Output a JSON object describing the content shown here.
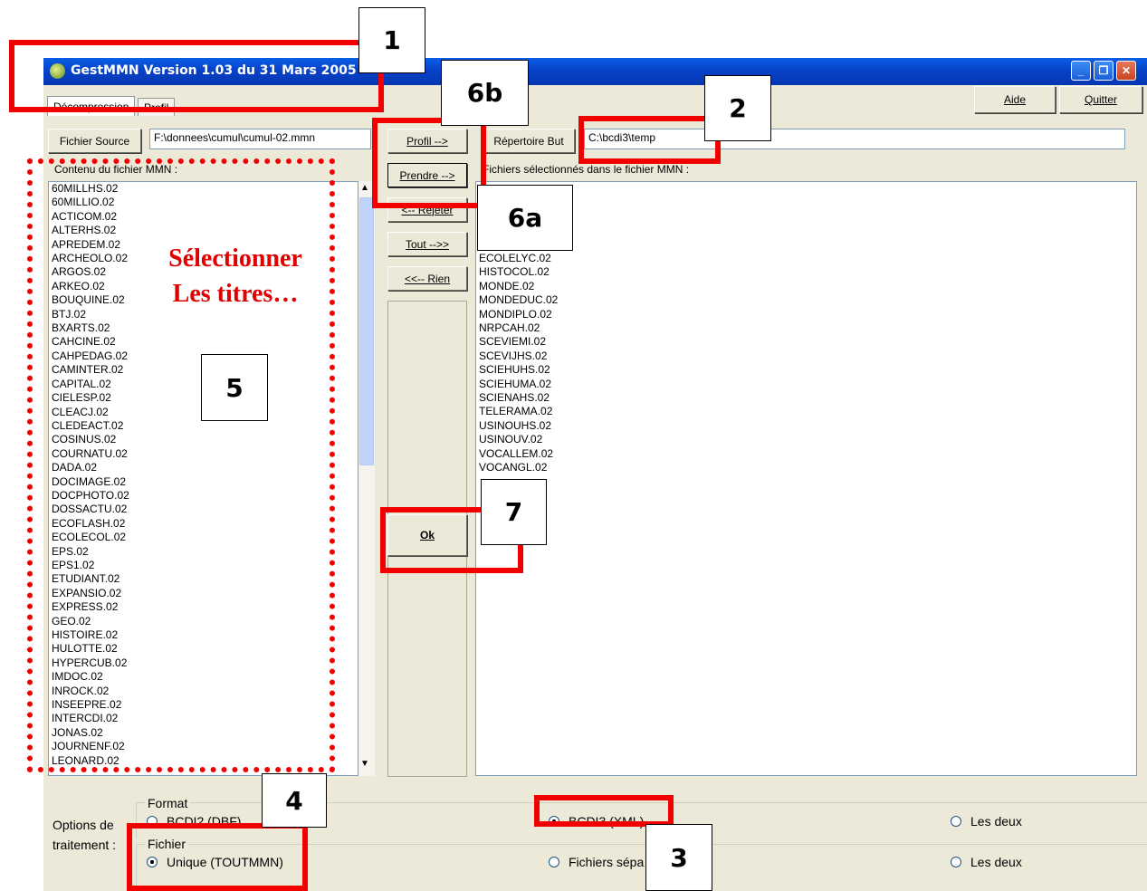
{
  "window": {
    "title": "GestMMN  Version 1.03 du 31 Mars 2005"
  },
  "tabs": [
    "Décompression",
    "Profil"
  ],
  "toolbar": {
    "aide": "Aide",
    "quitter": "Quitter"
  },
  "source": {
    "button": "Fichier Source",
    "value": "F:\\donnees\\cumul\\cumul-02.mmn"
  },
  "target": {
    "button": "Répertoire But",
    "value": "C:\\bcdi3\\temp"
  },
  "left_list": {
    "label": "Contenu du fichier MMN :",
    "items": [
      "60MILLHS.02",
      "60MILLIO.02",
      "ACTICOM.02",
      "ALTERHS.02",
      "APREDEM.02",
      "ARCHEOLO.02",
      "ARGOS.02",
      "ARKEO.02",
      "BOUQUINE.02",
      "BTJ.02",
      "BXARTS.02",
      "CAHCINE.02",
      "CAHPEDAG.02",
      "CAMINTER.02",
      "CAPITAL.02",
      "CIELESP.02",
      "CLEACJ.02",
      "CLEDEACT.02",
      "COSINUS.02",
      "COURNATU.02",
      "DADA.02",
      "DOCIMAGE.02",
      "DOCPHOTO.02",
      "DOSSACTU.02",
      "ECOFLASH.02",
      "ECOLECOL.02",
      "EPS.02",
      "EPS1.02",
      "ETUDIANT.02",
      "EXPANSIO.02",
      "EXPRESS.02",
      "GEO.02",
      "HISTOIRE.02",
      "HULOTTE.02",
      "HYPERCUB.02",
      "IMDOC.02",
      "INROCK.02",
      "INSEEPRE.02",
      "INTERCDI.02",
      "JONAS.02",
      "JOURNENF.02",
      "LEONARD.02"
    ]
  },
  "middle_buttons": {
    "profil": "Profil -->",
    "prendre": "Prendre -->",
    "rejeter": "<-- Rejeter",
    "tout": "Tout -->>",
    "rien": "<<-- Rien",
    "ok": "Ok"
  },
  "right_list": {
    "label": "Fichiers sélectionnés dans le fichier MMN :",
    "items": [
      "ECOLELYC.02",
      "HISTOCOL.02",
      "MONDE.02",
      "MONDEDUC.02",
      "MONDIPLO.02",
      "NRPCAH.02",
      "SCEVIEMI.02",
      "SCEVIJHS.02",
      "SCIEHUHS.02",
      "SCIEHUMA.02",
      "SCIENAHS.02",
      "TELERAMA.02",
      "USINOUHS.02",
      "USINOUV.02",
      "VOCALLEM.02",
      "VOCANGL.02"
    ]
  },
  "options": {
    "label1": "Options de",
    "label2": "traitement :",
    "format": {
      "title": "Format",
      "opt1": "BCDI2 (DBF)",
      "opt2": "BCDI3 (XML)",
      "opt3": "Les deux"
    },
    "fichier": {
      "title": "Fichier",
      "opt1": "Unique (TOUTMMN)",
      "opt2": "Fichiers sépa",
      "opt3": "Les deux"
    }
  },
  "annotations": {
    "select_line1": "Sélectionner",
    "select_line2": "Les titres…",
    "n1": "1",
    "n2": "2",
    "n3": "3",
    "n4": "4",
    "n5": "5",
    "n6a": "6a",
    "n6b": "6b",
    "n7": "7"
  },
  "colors": {
    "title_blue": "#0842c8",
    "annotation_red": "#f20000",
    "window_bg": "#ece9d8"
  }
}
